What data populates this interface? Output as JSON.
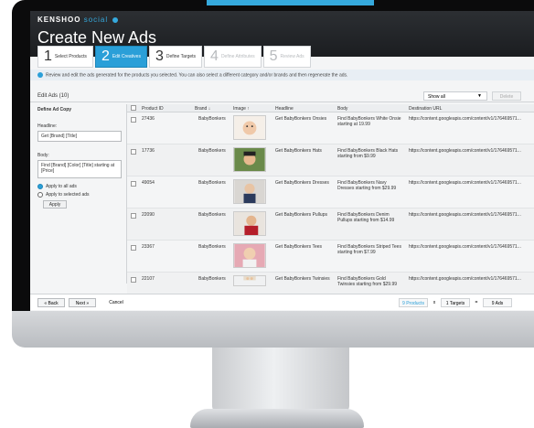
{
  "app": {
    "brand_main": "KENSHOO",
    "brand_sub": "social",
    "title": "Create New Ads"
  },
  "steps": [
    {
      "num": "1",
      "label": "Select Products",
      "state": "done"
    },
    {
      "num": "2",
      "label": "Edit Creatives",
      "state": "active"
    },
    {
      "num": "3",
      "label": "Define Targets",
      "state": "normal"
    },
    {
      "num": "4",
      "label": "Define Attributes",
      "state": "disabled"
    },
    {
      "num": "5",
      "label": "Review Ads",
      "state": "disabled"
    }
  ],
  "info_text": "Review and edit the ads generated for the products you selected. You can also select a different category and/or brands and then regenerate the ads.",
  "edit_bar": {
    "title": "Edit Ads (10)",
    "show_all": "Show all",
    "delete": "Delete"
  },
  "left_panel": {
    "heading": "Define Ad Copy",
    "headline_label": "Headline:",
    "headline_value": "Get [Brand] [Title]",
    "body_label": "Body:",
    "body_value": "Find [Brand] [Color] [Title] starting at [Price]",
    "apply_all": "Apply to all ads",
    "apply_selected": "Apply to selected ads",
    "apply_button": "Apply"
  },
  "table": {
    "headers": [
      "Product ID",
      "Brand",
      "Image",
      "Headline",
      "Body",
      "Destination URL"
    ],
    "rows": [
      {
        "id": "27436",
        "brand": "BabyBonkers",
        "headline": "Get BabyBonkers Onsies",
        "body": "Find BabyBonkers White Onsie starting at 19.99",
        "url": "https://content.googleapis.com/content/v1/176469571..."
      },
      {
        "id": "17736",
        "brand": "BabyBonkers",
        "headline": "Get BabyBonkers Hats",
        "body": "Find BabyBonkers Black Hats starting from $9.99",
        "url": "https://content.googleapis.com/content/v1/176469571..."
      },
      {
        "id": "49054",
        "brand": "BabyBonkers",
        "headline": "Get BabyBonkers Dresses",
        "body": "Find BabyBonkers Navy Dresses starting from $29.99",
        "url": "https://content.googleapis.com/content/v1/176469571..."
      },
      {
        "id": "22090",
        "brand": "BabyBonkers",
        "headline": "Get BabyBonkers Pullups",
        "body": "Find BabyBonkers Denim Pullups starting from $14.99",
        "url": "https://content.googleapis.com/content/v1/176469571..."
      },
      {
        "id": "23367",
        "brand": "BabyBonkers",
        "headline": "Get BabyBonkers Tees",
        "body": "Find BabyBonkers Striped Tees starting from $7.99",
        "url": "https://content.googleapis.com/content/v1/176469571..."
      },
      {
        "id": "22107",
        "brand": "BabyBonkers",
        "headline": "Get BabyBonkers Twinsies",
        "body": "Find BabyBonkers Gold Twinsies starting from $29.99",
        "url": "https://content.googleapis.com/content/v1/176469571..."
      }
    ]
  },
  "footer": {
    "back": "« Back",
    "next": "Next »",
    "cancel": "Cancel",
    "products": "9 Products",
    "x": "x",
    "targets": "1 Targets",
    "equals": "=",
    "ads": "9 Ads"
  },
  "colors": {
    "accent": "#2a9fd8",
    "header": "#1b1d20"
  }
}
